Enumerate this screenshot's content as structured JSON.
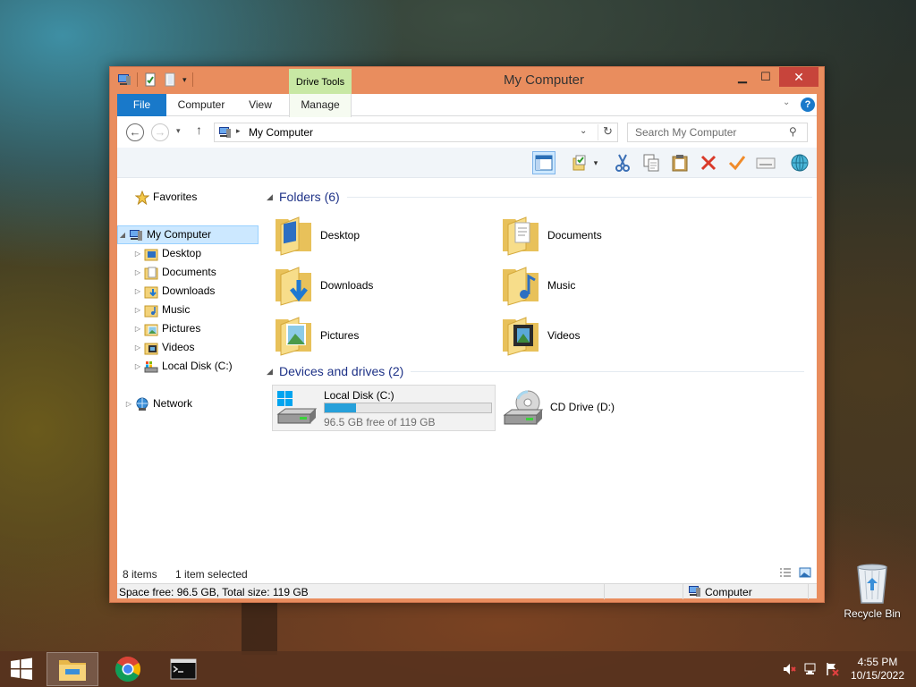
{
  "window": {
    "title": "My Computer",
    "contextual_tab_group": "Drive Tools",
    "controls": {
      "minimize": "▁",
      "maximize": "☐",
      "close": "✕"
    }
  },
  "ribbon": {
    "tabs": [
      "File",
      "Computer",
      "View",
      "Manage"
    ],
    "active_tab": "Manage"
  },
  "address_bar": {
    "crumb": "My Computer",
    "search_placeholder": "Search My Computer"
  },
  "toolbar": {
    "buttons": [
      "preview-pane",
      "properties",
      "cut",
      "copy",
      "paste",
      "delete",
      "rename",
      "keyboard",
      "map-network"
    ]
  },
  "nav_pane": {
    "favorites": "Favorites",
    "my_computer": "My Computer",
    "children": [
      "Desktop",
      "Documents",
      "Downloads",
      "Music",
      "Pictures",
      "Videos",
      "Local Disk (C:)"
    ],
    "network": "Network"
  },
  "content": {
    "folders_group": "Folders (6)",
    "folders": [
      "Desktop",
      "Documents",
      "Downloads",
      "Music",
      "Pictures",
      "Videos"
    ],
    "drives_group": "Devices and drives (2)",
    "drives": [
      {
        "name": "Local Disk (C:)",
        "free_text": "96.5 GB free of 119 GB",
        "used_fraction": 0.19
      },
      {
        "name": "CD Drive (D:)"
      }
    ]
  },
  "status": {
    "items": "8 items",
    "selected": "1 item selected"
  },
  "details_bar": {
    "space": "Space free: 96.5 GB, Total size: 119 GB",
    "location": "Computer"
  },
  "desktop": {
    "recycle_bin": "Recycle Bin"
  },
  "taskbar": {
    "time": "4:55 PM",
    "date": "10/15/2022"
  },
  "colors": {
    "window_frame": "#e98d5e",
    "ribbon_file": "#1979ca",
    "close_button": "#c7443b",
    "group_title": "#1e3287",
    "progress_fill": "#26a0da",
    "taskbar": "#56321e"
  }
}
